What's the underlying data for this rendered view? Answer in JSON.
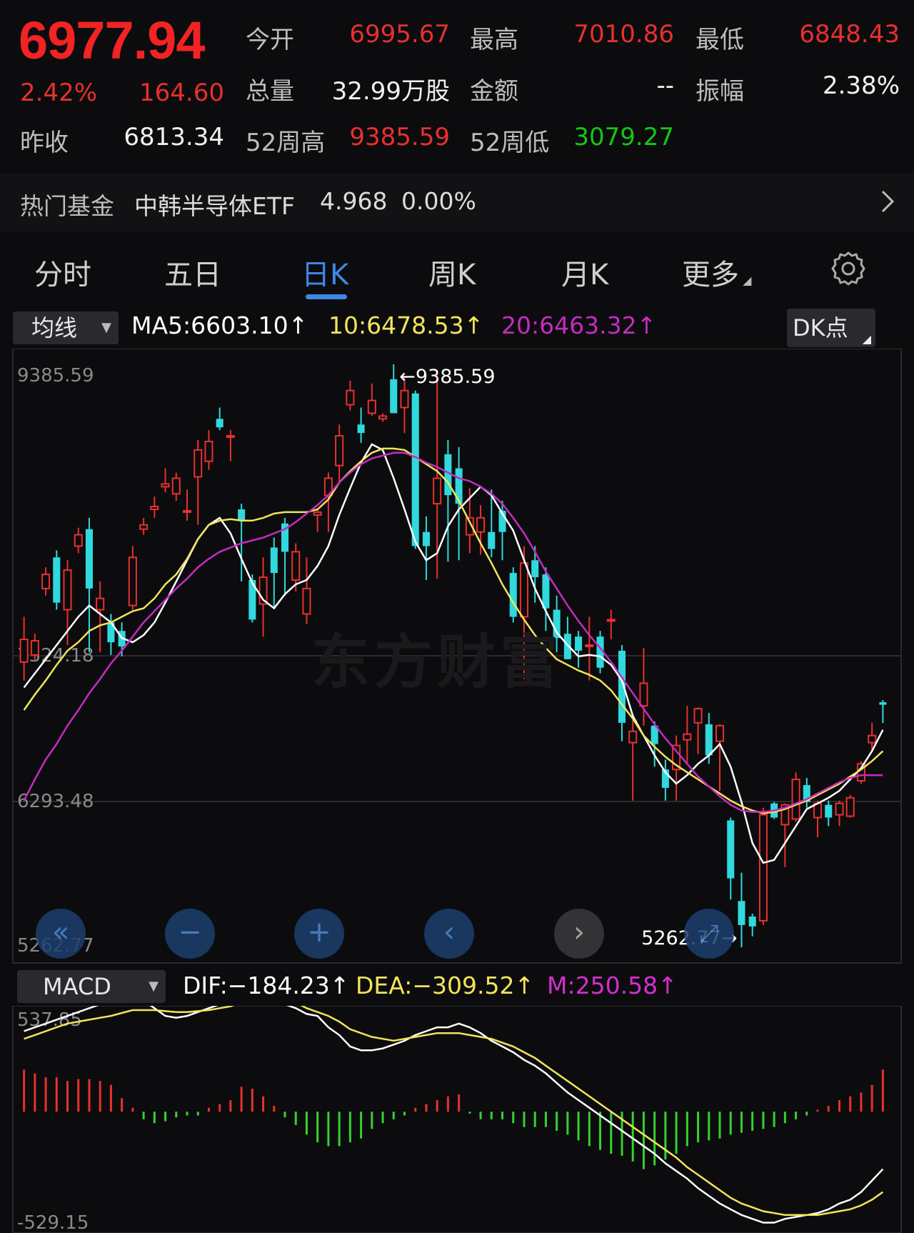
{
  "quote": {
    "price": "6977.94",
    "change_pct": "2.42%",
    "change": "164.60",
    "open_label": "今开",
    "open": "6995.67",
    "high_label": "最高",
    "high": "7010.86",
    "low_label": "最低",
    "low": "6848.43",
    "vol_label": "总量",
    "vol": "32.99万股",
    "amt_label": "金额",
    "amt": "--",
    "amp_label": "振幅",
    "amp": "2.38%",
    "prev_label": "昨收",
    "prev": "6813.34",
    "h52_label": "52周高",
    "h52": "9385.59",
    "l52_label": "52周低",
    "l52": "3079.27"
  },
  "fund": {
    "label": "热门基金",
    "name": "中韩半导体ETF",
    "price": "4.968",
    "change": "0.00%"
  },
  "tabs": [
    {
      "label": "分时"
    },
    {
      "label": "五日"
    },
    {
      "label": "日K"
    },
    {
      "label": "周K"
    },
    {
      "label": "月K"
    },
    {
      "label": "更多"
    }
  ],
  "ma_bar": {
    "selector": "均线",
    "ma5": "MA5:6603.10↑",
    "ma10": "10:6478.53↑",
    "ma20": "20:6463.32↑",
    "dk": "DK点"
  },
  "macd_bar": {
    "selector": "MACD",
    "dif": "DIF:−184.23↑",
    "dea": "DEA:−309.52↑",
    "m": "M:250.58↑"
  },
  "colors": {
    "up": "#e8302e",
    "down": "#2fd9dd",
    "ma5": "#ffffff",
    "ma10": "#f2e45c",
    "ma20": "#c52bc0",
    "hist_up": "#e8302e",
    "hist_down": "#36d12f"
  },
  "chart_data": [
    {
      "type": "candlestick",
      "title": "",
      "ylim": [
        5262.77,
        9385.59
      ],
      "yticks": [
        "9385.59",
        "7324.18",
        "6293.48",
        "5262.77"
      ],
      "annotations": {
        "high": "←9385.59",
        "low": "5262.77→"
      },
      "candles": [
        {
          "o": 7280,
          "c": 7440,
          "h": 7600,
          "l": 7150
        },
        {
          "o": 7330,
          "c": 7430,
          "h": 7480,
          "l": 7290
        },
        {
          "o": 7800,
          "c": 7900,
          "h": 7950,
          "l": 7750
        },
        {
          "o": 8020,
          "c": 7700,
          "h": 8070,
          "l": 7650
        },
        {
          "o": 7650,
          "c": 7930,
          "h": 8000,
          "l": 7400
        },
        {
          "o": 8100,
          "c": 8180,
          "h": 8230,
          "l": 8050
        },
        {
          "o": 8220,
          "c": 7800,
          "h": 8300,
          "l": 7350
        },
        {
          "o": 7650,
          "c": 7730,
          "h": 7850,
          "l": 7350
        },
        {
          "o": 7560,
          "c": 7420,
          "h": 7620,
          "l": 7330
        },
        {
          "o": 7500,
          "c": 7390,
          "h": 7560,
          "l": 7320
        },
        {
          "o": 7680,
          "c": 8020,
          "h": 8100,
          "l": 7650
        },
        {
          "o": 8220,
          "c": 8250,
          "h": 8300,
          "l": 8180
        },
        {
          "o": 8360,
          "c": 8380,
          "h": 8450,
          "l": 8300
        },
        {
          "o": 8520,
          "c": 8540,
          "h": 8650,
          "l": 8480
        },
        {
          "o": 8470,
          "c": 8580,
          "h": 8620,
          "l": 8420
        },
        {
          "o": 8340,
          "c": 8350,
          "h": 8500,
          "l": 8280
        },
        {
          "o": 8590,
          "c": 8780,
          "h": 8850,
          "l": 8250
        },
        {
          "o": 8700,
          "c": 8840,
          "h": 8920,
          "l": 8640
        },
        {
          "o": 9000,
          "c": 8940,
          "h": 9080,
          "l": 8920
        },
        {
          "o": 8880,
          "c": 8880,
          "h": 8920,
          "l": 8700
        },
        {
          "o": 8360,
          "c": 8280,
          "h": 8400,
          "l": 7850
        },
        {
          "o": 7860,
          "c": 7580,
          "h": 7900,
          "l": 7560
        },
        {
          "o": 7690,
          "c": 7880,
          "h": 8020,
          "l": 7460
        },
        {
          "o": 8090,
          "c": 7910,
          "h": 8160,
          "l": 7670
        },
        {
          "o": 8260,
          "c": 8060,
          "h": 8300,
          "l": 7750
        },
        {
          "o": 7860,
          "c": 8060,
          "h": 8120,
          "l": 7780
        },
        {
          "o": 7620,
          "c": 7800,
          "h": 8020,
          "l": 7550
        },
        {
          "o": 8320,
          "c": 8340,
          "h": 8360,
          "l": 8200
        },
        {
          "o": 8460,
          "c": 8580,
          "h": 8620,
          "l": 8200
        },
        {
          "o": 8670,
          "c": 8880,
          "h": 8960,
          "l": 8540
        },
        {
          "o": 9100,
          "c": 9200,
          "h": 9270,
          "l": 9060
        },
        {
          "o": 8960,
          "c": 8900,
          "h": 9080,
          "l": 8830
        },
        {
          "o": 9040,
          "c": 9130,
          "h": 9250,
          "l": 9020
        },
        {
          "o": 9000,
          "c": 9020,
          "h": 9040,
          "l": 8980
        },
        {
          "o": 9280,
          "c": 9040,
          "h": 9385.59,
          "l": 9040
        },
        {
          "o": 9080,
          "c": 9200,
          "h": 9300,
          "l": 8900
        },
        {
          "o": 9180,
          "c": 8100,
          "h": 9200,
          "l": 8080
        },
        {
          "o": 8200,
          "c": 8100,
          "h": 8310,
          "l": 7860
        },
        {
          "o": 8400,
          "c": 8580,
          "h": 9320,
          "l": 7870
        },
        {
          "o": 8750,
          "c": 8460,
          "h": 8850,
          "l": 7990
        },
        {
          "o": 8650,
          "c": 8400,
          "h": 8800,
          "l": 8000
        },
        {
          "o": 8180,
          "c": 8300,
          "h": 8510,
          "l": 8050
        },
        {
          "o": 8200,
          "c": 8300,
          "h": 8390,
          "l": 8040
        },
        {
          "o": 8200,
          "c": 8080,
          "h": 8500,
          "l": 8020
        },
        {
          "o": 8350,
          "c": 8200,
          "h": 8420,
          "l": 8000
        },
        {
          "o": 7910,
          "c": 7600,
          "h": 7950,
          "l": 7560
        },
        {
          "o": 7600,
          "c": 7980,
          "h": 8100,
          "l": 7160
        },
        {
          "o": 8000,
          "c": 7880,
          "h": 8100,
          "l": 7700
        },
        {
          "o": 7900,
          "c": 7660,
          "h": 7950,
          "l": 7500
        },
        {
          "o": 7650,
          "c": 7450,
          "h": 7750,
          "l": 7350
        },
        {
          "o": 7480,
          "c": 7300,
          "h": 7600,
          "l": 7300
        },
        {
          "o": 7460,
          "c": 7360,
          "h": 7500,
          "l": 7240
        },
        {
          "o": 7400,
          "c": 7400,
          "h": 7600,
          "l": 7150
        },
        {
          "o": 7460,
          "c": 7240,
          "h": 7500,
          "l": 7200
        },
        {
          "o": 7580,
          "c": 7580,
          "h": 7650,
          "l": 7440
        },
        {
          "o": 7360,
          "c": 6850,
          "h": 7400,
          "l": 6720
        },
        {
          "o": 6710,
          "c": 6790,
          "h": 6870,
          "l": 6300
        },
        {
          "o": 6970,
          "c": 7130,
          "h": 7380,
          "l": 6830
        },
        {
          "o": 6830,
          "c": 6700,
          "h": 6860,
          "l": 6540
        },
        {
          "o": 6520,
          "c": 6390,
          "h": 6590,
          "l": 6300
        },
        {
          "o": 6520,
          "c": 6690,
          "h": 6760,
          "l": 6300
        },
        {
          "o": 6730,
          "c": 6770,
          "h": 6970,
          "l": 6560
        },
        {
          "o": 6850,
          "c": 6950,
          "h": 6960,
          "l": 6630
        },
        {
          "o": 6840,
          "c": 6620,
          "h": 6920,
          "l": 6560
        },
        {
          "o": 6720,
          "c": 6830,
          "h": 6840,
          "l": 6370
        },
        {
          "o": 6160,
          "c": 5750,
          "h": 6180,
          "l": 5600
        },
        {
          "o": 5590,
          "c": 5420,
          "h": 5790,
          "l": 5262.77
        },
        {
          "o": 5480,
          "c": 5410,
          "h": 5500,
          "l": 5340
        },
        {
          "o": 5450,
          "c": 6200,
          "h": 6250,
          "l": 5420
        },
        {
          "o": 6280,
          "c": 6180,
          "h": 6290,
          "l": 6170
        },
        {
          "o": 6130,
          "c": 6270,
          "h": 6280,
          "l": 5830
        },
        {
          "o": 6170,
          "c": 6450,
          "h": 6500,
          "l": 6150
        },
        {
          "o": 6410,
          "c": 6290,
          "h": 6460,
          "l": 6250
        },
        {
          "o": 6180,
          "c": 6280,
          "h": 6300,
          "l": 6040
        },
        {
          "o": 6270,
          "c": 6180,
          "h": 6300,
          "l": 6120
        },
        {
          "o": 6200,
          "c": 6280,
          "h": 6300,
          "l": 6120
        },
        {
          "o": 6190,
          "c": 6320,
          "h": 6340,
          "l": 6180
        },
        {
          "o": 6440,
          "c": 6560,
          "h": 6580,
          "l": 6420
        },
        {
          "o": 6710,
          "c": 6760,
          "h": 6850,
          "l": 6650
        },
        {
          "o": 6995.67,
          "c": 6977.94,
          "h": 7010.86,
          "l": 6848.43
        }
      ],
      "series": [
        {
          "values": [
            7100,
            7200,
            7300,
            7400,
            7500,
            7600,
            7680,
            7620,
            7560,
            7450,
            7420,
            7470,
            7560,
            7700,
            7850,
            8000,
            8150,
            8250,
            8300,
            8190,
            8010,
            7840,
            7720,
            7660,
            7760,
            7830,
            7860,
            7960,
            8100,
            8320,
            8510,
            8690,
            8820,
            8780,
            8580,
            8360,
            8130,
            8000,
            8050,
            8240,
            8360,
            8440,
            8520,
            8460,
            8330,
            8210,
            8000,
            7800,
            7640,
            7490,
            7400,
            7320,
            7330,
            7320,
            7260,
            7150,
            6900,
            6760,
            6620,
            6500,
            6420,
            6480,
            6560,
            6620,
            6700,
            6540,
            6290,
            6000,
            5860,
            5880,
            6000,
            6120,
            6240,
            6280,
            6320,
            6370,
            6450,
            6530,
            6650,
            6800
          ]
        },
        {
          "values": [
            6940,
            7050,
            7150,
            7260,
            7360,
            7420,
            7500,
            7540,
            7560,
            7600,
            7640,
            7660,
            7730,
            7830,
            7900,
            8010,
            8150,
            8250,
            8280,
            8290,
            8280,
            8280,
            8300,
            8330,
            8340,
            8340,
            8340,
            8360,
            8430,
            8550,
            8630,
            8700,
            8760,
            8790,
            8790,
            8780,
            8730,
            8680,
            8630,
            8550,
            8420,
            8270,
            8120,
            7980,
            7830,
            7700,
            7580,
            7470,
            7380,
            7300,
            7260,
            7220,
            7190,
            7150,
            7080,
            6980,
            6880,
            6760,
            6680,
            6610,
            6550,
            6500,
            6450,
            6400,
            6350,
            6300,
            6260,
            6230,
            6210,
            6220,
            6240,
            6270,
            6300,
            6340,
            6380,
            6420,
            6470,
            6520,
            6580,
            6650
          ]
        },
        {
          "values": [
            6300,
            6450,
            6590,
            6700,
            6830,
            6940,
            7060,
            7160,
            7270,
            7360,
            7460,
            7560,
            7640,
            7720,
            7800,
            7870,
            7950,
            8010,
            8060,
            8090,
            8120,
            8140,
            8160,
            8190,
            8220,
            8270,
            8330,
            8390,
            8460,
            8550,
            8620,
            8680,
            8720,
            8740,
            8760,
            8760,
            8730,
            8690,
            8660,
            8620,
            8580,
            8560,
            8520,
            8470,
            8400,
            8300,
            8190,
            8060,
            7920,
            7800,
            7680,
            7570,
            7470,
            7380,
            7280,
            7170,
            7060,
            6950,
            6840,
            6740,
            6650,
            6560,
            6470,
            6400,
            6330,
            6270,
            6230,
            6220,
            6220,
            6230,
            6250,
            6280,
            6310,
            6350,
            6390,
            6430,
            6460,
            6480,
            6480,
            6480
          ]
        }
      ]
    },
    {
      "type": "macd",
      "title": "",
      "ylim": [
        -529.15,
        537.85
      ],
      "yticks": [
        "537.85",
        "-529.15"
      ],
      "series": [
        {
          "name": "DIF",
          "values": [
            480,
            500,
            520,
            540,
            560,
            580,
            600,
            620,
            640,
            660,
            660,
            640,
            600,
            560,
            550,
            560,
            580,
            600,
            620,
            640,
            690,
            700,
            680,
            650,
            620,
            600,
            570,
            560,
            500,
            460,
            400,
            380,
            380,
            390,
            410,
            430,
            460,
            480,
            500,
            500,
            520,
            500,
            470,
            430,
            400,
            370,
            330,
            300,
            260,
            210,
            160,
            120,
            80,
            40,
            0,
            -40,
            -80,
            -120,
            -160,
            -210,
            -250,
            -290,
            -340,
            -380,
            -420,
            -450,
            -480,
            -500,
            -520,
            -520,
            -500,
            -490,
            -480,
            -470,
            -450,
            -420,
            -400,
            -360,
            -300,
            -240
          ]
        },
        {
          "name": "DEA",
          "values": [
            440,
            460,
            480,
            500,
            520,
            530,
            540,
            550,
            560,
            575,
            590,
            590,
            590,
            585,
            580,
            580,
            585,
            590,
            600,
            610,
            630,
            650,
            660,
            650,
            640,
            630,
            600,
            580,
            560,
            530,
            490,
            470,
            450,
            440,
            430,
            440,
            450,
            460,
            470,
            470,
            470,
            460,
            450,
            440,
            420,
            400,
            370,
            340,
            300,
            260,
            220,
            180,
            140,
            100,
            60,
            20,
            -20,
            -60,
            -100,
            -140,
            -180,
            -230,
            -270,
            -310,
            -350,
            -390,
            -420,
            -440,
            -460,
            -470,
            -480,
            -480,
            -480,
            -480,
            -470,
            -460,
            -450,
            -430,
            -400,
            -360
          ]
        },
        {
          "name": "M",
          "values": [
            220,
            200,
            180,
            180,
            160,
            170,
            170,
            160,
            140,
            70,
            20,
            -40,
            -60,
            -50,
            -30,
            -20,
            -20,
            20,
            40,
            60,
            130,
            120,
            80,
            30,
            -30,
            -70,
            -120,
            -160,
            -180,
            -180,
            -160,
            -140,
            -90,
            -60,
            -40,
            -20,
            20,
            40,
            60,
            80,
            90,
            -10,
            -40,
            -40,
            -40,
            -60,
            -80,
            -80,
            -80,
            -100,
            -120,
            -150,
            -180,
            -200,
            -220,
            -230,
            -260,
            -300,
            -280,
            -250,
            -220,
            -180,
            -160,
            -150,
            -140,
            -120,
            -110,
            -100,
            -90,
            -80,
            -60,
            -40,
            -20,
            10,
            30,
            60,
            80,
            100,
            140,
            220
          ]
        }
      ]
    }
  ]
}
